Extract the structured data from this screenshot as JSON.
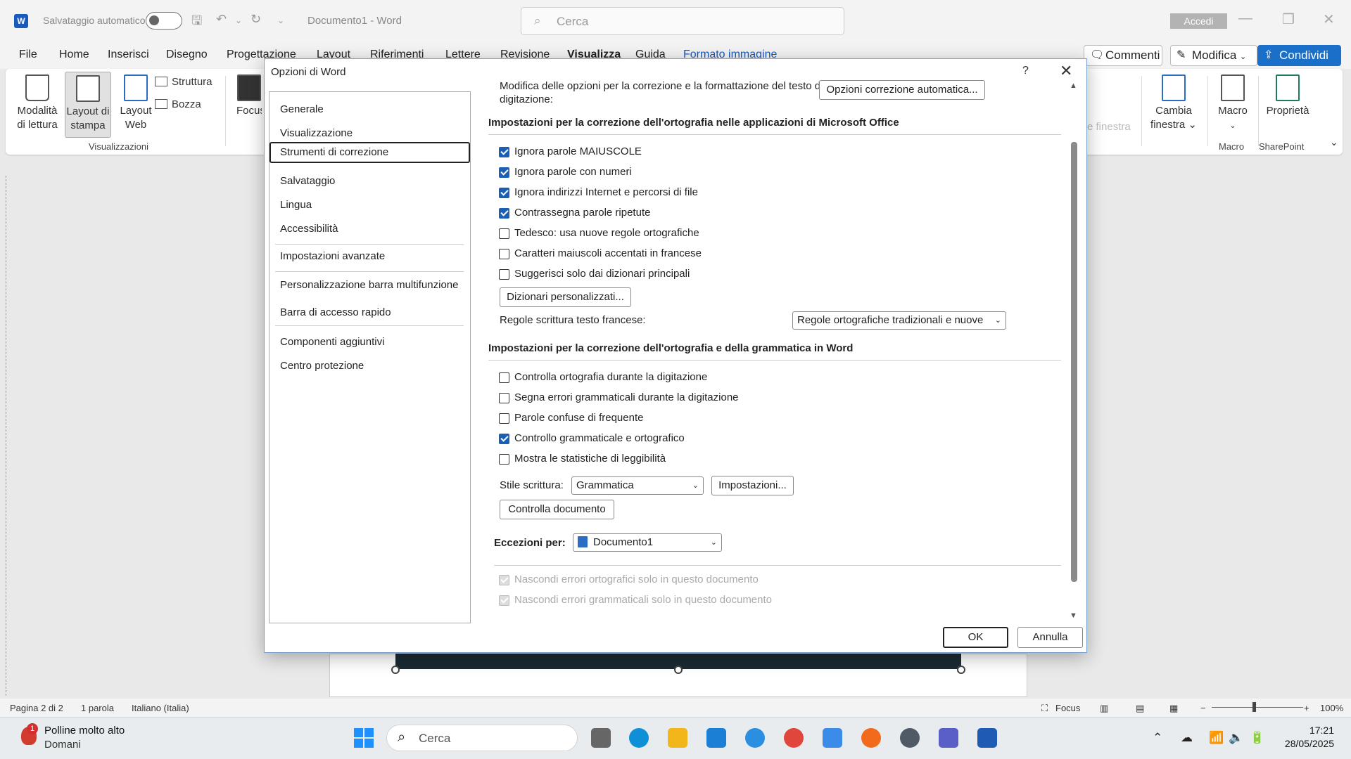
{
  "app": {
    "autosave_label": "Salvataggio automatico",
    "doc_title": "Documento1  -  Word",
    "search_placeholder": "Cerca",
    "signin_label": "Accedi"
  },
  "ribbon_tabs": [
    "File",
    "Home",
    "Inserisci",
    "Disegno",
    "Progettazione",
    "Layout",
    "Riferimenti",
    "Lettere",
    "Revisione",
    "Visualizza",
    "Guida",
    "Formato immagine"
  ],
  "ribbon_buttons": {
    "comments": "Commenti",
    "edit": "Modifica",
    "share": "Condividi"
  },
  "ribbon": {
    "reading_mode": [
      "Modalità",
      "di lettura"
    ],
    "print_layout": [
      "Layout di",
      "stampa"
    ],
    "web_layout": [
      "Layout",
      "Web"
    ],
    "outline": "Struttura",
    "draft": "Bozza",
    "views_group": "Visualizzazioni",
    "focus": "Focus",
    "new_window_faded": "e finestra",
    "switch_window": [
      "Cambia",
      "finestra ⌄"
    ],
    "macros": "Macro",
    "macros_group": "Macro",
    "properties": "Proprietà",
    "sharepoint_group": "SharePoint"
  },
  "statusbar": {
    "page": "Pagina 2 di 2",
    "words": "1 parola",
    "language": "Italiano (Italia)",
    "focus": "Focus",
    "zoom": "100%"
  },
  "taskbar": {
    "weather_badge": "1",
    "weather_title": "Polline molto alto",
    "weather_sub": "Domani",
    "search_placeholder": "Cerca",
    "time": "17:21",
    "date": "28/05/2025"
  },
  "dialog": {
    "title": "Opzioni di Word",
    "help": "?",
    "nav": [
      "Generale",
      "Visualizzazione",
      "Strumenti di correzione",
      "Salvataggio",
      "Lingua",
      "Accessibilità",
      "Impostazioni avanzate",
      "Personalizzazione barra multifunzione",
      "Barra di accesso rapido",
      "Componenti aggiuntivi",
      "Centro protezione"
    ],
    "autocorrect_desc": [
      "Modifica delle opzioni per la correzione e la formattazione del testo durante la",
      "digitazione:"
    ],
    "autocorrect_btn": "Opzioni correzione automatica...",
    "section_office": "Impostazioni per la correzione dell'ortografia nelle applicazioni di Microsoft Office",
    "office_options": [
      {
        "label": "Ignora parole MAIUSCOLE",
        "checked": true
      },
      {
        "label": "Ignora parole con numeri",
        "checked": true
      },
      {
        "label": "Ignora indirizzi Internet e percorsi di file",
        "checked": true
      },
      {
        "label": "Contrassegna parole ripetute",
        "checked": true
      },
      {
        "label": "Tedesco: usa nuove regole ortografiche",
        "checked": false
      },
      {
        "label": "Caratteri maiuscoli accentati in francese",
        "checked": false
      },
      {
        "label": "Suggerisci solo dai dizionari principali",
        "checked": false
      }
    ],
    "custom_dict_btn": "Dizionari personalizzati...",
    "french_rules_label": "Regole scrittura testo francese:",
    "french_rules_value": "Regole ortografiche tradizionali e nuove",
    "section_word": "Impostazioni per la correzione dell'ortografia e della grammatica in Word",
    "word_options": [
      {
        "label": "Controlla ortografia durante la digitazione",
        "checked": false
      },
      {
        "label": "Segna errori grammaticali durante la digitazione",
        "checked": false
      },
      {
        "label": "Parole confuse di frequente",
        "checked": false
      },
      {
        "label": "Controllo grammaticale e ortografico",
        "checked": true
      },
      {
        "label": "Mostra le statistiche di leggibilità",
        "checked": false
      }
    ],
    "writing_style_label": "Stile scrittura:",
    "writing_style_value": "Grammatica",
    "settings_btn": "Impostazioni...",
    "check_doc_btn": "Controlla documento",
    "exceptions_label": "Eccezioni per:",
    "exceptions_value": "Documento1",
    "exception_options": [
      {
        "label": "Nascondi errori ortografici solo in questo documento",
        "checked": true
      },
      {
        "label": "Nascondi errori grammaticali solo in questo documento",
        "checked": true
      }
    ],
    "ok": "OK",
    "cancel": "Annulla"
  }
}
